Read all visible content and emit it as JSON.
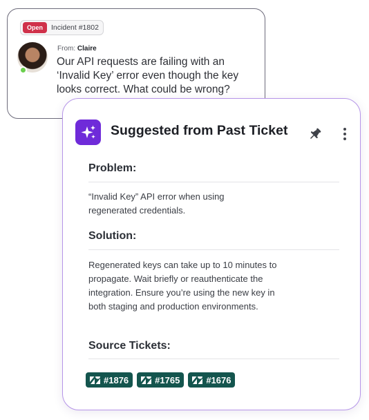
{
  "incident": {
    "status": "Open",
    "number": "Incident #1802",
    "from_label": "From:",
    "from_name": "Claire",
    "message": "Our API requests are failing with an ‘Invalid Key’ error even though the key looks correct. What could be wrong?"
  },
  "suggestion": {
    "title": "Suggested from Past Ticket",
    "icons": {
      "header": "sparkles-icon",
      "pin": "pin-icon",
      "more": "more-vertical-icon",
      "ticket": "zendesk-icon"
    },
    "problem": {
      "heading": "Problem:",
      "text": "“Invalid Key” API error when using regenerated credentials."
    },
    "solution": {
      "heading": "Solution:",
      "text": "Regenerated keys can take up to 10 minutes to propagate. Wait briefly or reauthenticate the integration. Ensure you’re using the new key in both staging and production environments."
    },
    "sources": {
      "heading": "Source Tickets:",
      "tickets": [
        "#1876",
        "#1765",
        "#1676"
      ]
    }
  },
  "colors": {
    "open_badge": "#d0314a",
    "accent_purple": "#6f2bd9",
    "card_border": "#b594e8",
    "ticket_chip": "#14554e",
    "online": "#6bcf4e"
  }
}
